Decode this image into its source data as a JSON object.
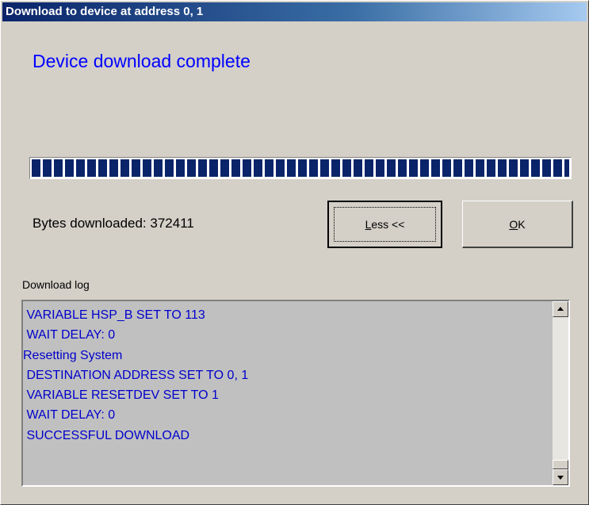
{
  "window": {
    "title": "Download to device at address 0, 1"
  },
  "status": {
    "headline": "Device download complete"
  },
  "progress": {
    "value": 1.0,
    "fill_color": "#0a246a"
  },
  "bytes": {
    "label": "Bytes downloaded:  372411"
  },
  "buttons": {
    "less": {
      "mnemonic": "L",
      "rest": "ess <<"
    },
    "ok": {
      "mnemonic": "O",
      "rest": "K"
    }
  },
  "log": {
    "label": "Download log",
    "lines": [
      " VARIABLE HSP_B SET TO 113",
      " WAIT DELAY: 0",
      "Resetting System",
      " DESTINATION ADDRESS SET TO 0, 1",
      " VARIABLE RESETDEV SET TO 1",
      " WAIT DELAY: 0",
      " SUCCESSFUL DOWNLOAD"
    ]
  },
  "colors": {
    "headline": "#0000ff",
    "log_text": "#0000cc",
    "title_start": "#0a246a",
    "title_end": "#a6caf0",
    "face": "#d4d0c8"
  },
  "icons": {
    "scroll_up": "triangle-up",
    "scroll_down": "triangle-down"
  }
}
